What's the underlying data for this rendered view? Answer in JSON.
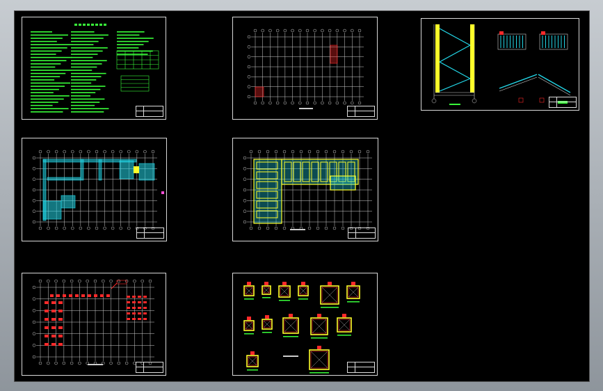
{
  "window": {
    "title": ""
  },
  "canvas": {
    "background": "#000000"
  },
  "colors": {
    "border": "#d9d9d9",
    "text_green": "#39ff3a",
    "cyan": "#23d7e8",
    "yellow": "#ffff2a",
    "red": "#ff2a2a",
    "magenta": "#ff4fd8",
    "grid": "#cfcfcf"
  },
  "sheets": [
    {
      "id": "design-notes",
      "kind": "notes"
    },
    {
      "id": "foundation-plan",
      "kind": "grid"
    },
    {
      "id": "stair-detail",
      "kind": "stair"
    },
    {
      "id": "floor-plan-cyan",
      "kind": "cyan-plan"
    },
    {
      "id": "beam-plan",
      "kind": "beam-plan"
    },
    {
      "id": "rebar-plan",
      "kind": "red-plan"
    },
    {
      "id": "column-sections",
      "kind": "columns"
    }
  ]
}
